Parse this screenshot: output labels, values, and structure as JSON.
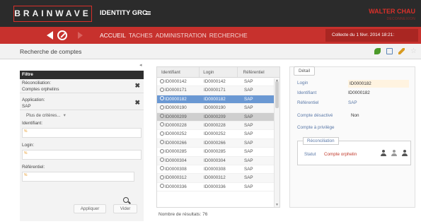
{
  "header": {
    "logo": "BRAINWAVE",
    "app_title": "IDENTITY GRC",
    "user_name": "WALTER CHAU",
    "logout": "DECONNEXION"
  },
  "nav": {
    "items": [
      "ACCUEIL",
      "TACHES",
      "ADMINISTRATION",
      "RECHERCHE"
    ],
    "collect": "Collecte du 1 févr. 2014 18:21:"
  },
  "page": {
    "title": "Recherche de comptes"
  },
  "filter": {
    "title": "Filtre",
    "criteria": [
      {
        "key": "Réconciliation:",
        "value": "Comptes orphelins"
      },
      {
        "key": "Application:",
        "value": "SAP"
      }
    ],
    "more_criteria": "Plus de critères...",
    "fields": [
      {
        "label": "Identifiant:",
        "value": "%"
      },
      {
        "label": "Login:",
        "value": "%"
      },
      {
        "label": "Référentiel:",
        "value": "%"
      }
    ],
    "apply_label": "Appliquer",
    "clear_label": "Vider"
  },
  "grid": {
    "columns": [
      "Identifiant",
      "Login",
      "Référentiel"
    ],
    "rows": [
      {
        "id": "ID0000142",
        "login": "ID0000142",
        "ref": "SAP"
      },
      {
        "id": "ID0000171",
        "login": "ID0000171",
        "ref": "SAP"
      },
      {
        "id": "ID0000182",
        "login": "ID0000182",
        "ref": "SAP"
      },
      {
        "id": "ID0000190",
        "login": "ID0000190",
        "ref": "SAP"
      },
      {
        "id": "ID0000209",
        "login": "ID0000209",
        "ref": "SAP"
      },
      {
        "id": "ID0000228",
        "login": "ID0000228",
        "ref": "SAP"
      },
      {
        "id": "ID0000252",
        "login": "ID0000252",
        "ref": "SAP"
      },
      {
        "id": "ID0000266",
        "login": "ID0000266",
        "ref": "SAP"
      },
      {
        "id": "ID0000285",
        "login": "ID0000285",
        "ref": "SAP"
      },
      {
        "id": "ID0000304",
        "login": "ID0000304",
        "ref": "SAP"
      },
      {
        "id": "ID0000308",
        "login": "ID0000308",
        "ref": "SAP"
      },
      {
        "id": "ID0000312",
        "login": "ID0000312",
        "ref": "SAP"
      },
      {
        "id": "ID0000336",
        "login": "ID0000336",
        "ref": "SAP"
      }
    ],
    "selected_row": 2,
    "hover_row": 4,
    "results_label": "Nombre de résultats: 76"
  },
  "detail": {
    "tab": "Détail",
    "fields": [
      {
        "label": "Login",
        "value": "ID0000182"
      },
      {
        "label": "Identifiant",
        "value": "ID0000182"
      },
      {
        "label": "Référentiel",
        "value": "SAP"
      },
      {
        "label": "Compte désactivé",
        "value": "Non"
      },
      {
        "label": "Compte à privilège",
        "value": ""
      }
    ],
    "reconciliation": {
      "title": "Réconciliation",
      "status_label": "Statut",
      "status_value": "Compte orphelin"
    }
  },
  "colors": {
    "brand_red": "#c7312d",
    "header_dark": "#2b2b2b",
    "selection_blue": "#6a98d3"
  },
  "icons": [
    "back-arrow-icon",
    "home-icon",
    "forward-arrow-icon",
    "leaf-icon",
    "screen-icon",
    "pencil-icon",
    "star-icon",
    "search-icon",
    "user-icon"
  ]
}
